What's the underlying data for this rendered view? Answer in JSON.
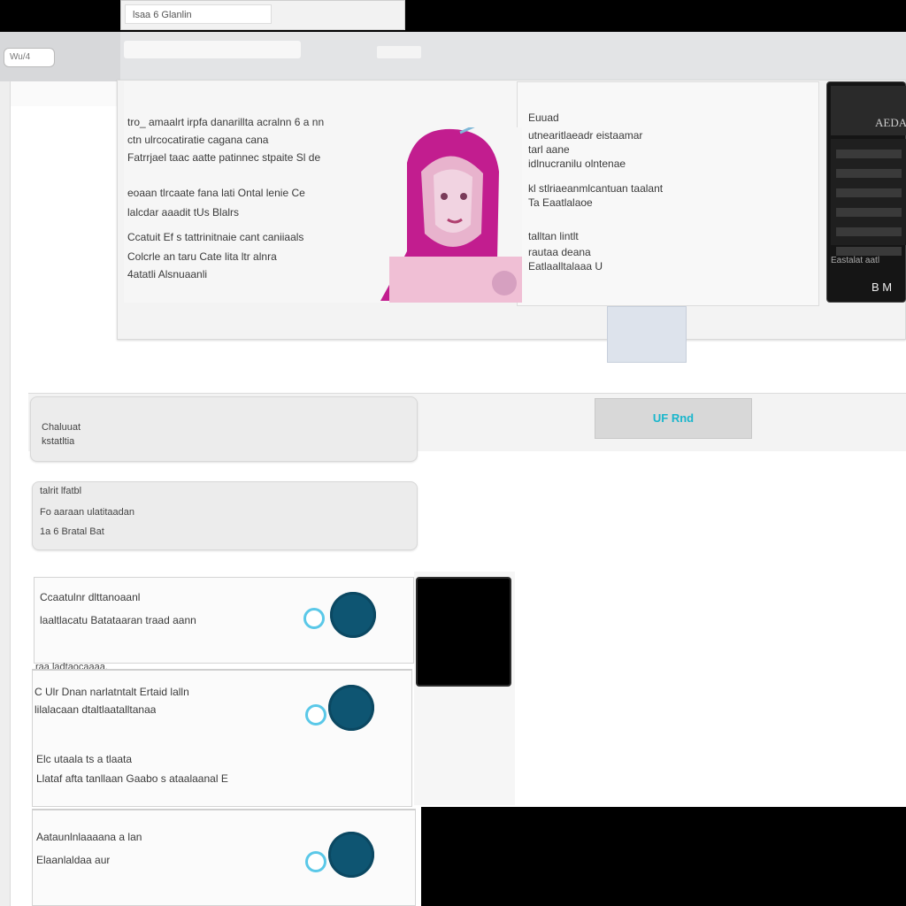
{
  "window": {
    "tab_label": "lsaa  6  Glanlin"
  },
  "toolbar": {
    "badge": "Wu/4"
  },
  "document": {
    "left_lines": [
      "tro_ amaalrt irpfa  danarillta acralnn  6 a nn",
      "ctn ulrcocatiratie cagana cana",
      "Fatrrjael  taac aatte patinnec  stpaite  Sl  de",
      "eoaan tlrcaate  fana lati  Ontal lenie Ce",
      "lalcdar  aaadit  tUs  Blalrs",
      "Ccatuit Ef s tattrinitnaie cant caniiaals",
      "Colcrle  an  taru  Cate lita ltr  alnra",
      "4atatli  Alsnuaanli"
    ],
    "right_lines": [
      "Euuad",
      "utnearitlaeadr  eistaamar",
      "tarl aane",
      "idlnucranilu  olntenae",
      "kl  stlriaeanmlcantuan  taalant",
      "Ta  Eaatlalaoe",
      "talltan lintlt",
      "rautaa deana",
      "Eatlaalltalaaa  U"
    ],
    "dark_header": "AEDAL",
    "dark_footer": "Eastalat aatl",
    "dark_page": "B  M"
  },
  "filter": {
    "button_label": "UF Rnd"
  },
  "search_card": {
    "line1": "Chaluuat",
    "line2": "kstatltia"
  },
  "info_card": {
    "line1": "talrit lfatbl",
    "line2": "Fo  aaraan ulatitaadan",
    "line3": "1a  6  Bratal  Bat"
  },
  "rows": [
    {
      "title": "Ccaatulnr  dlttanoaanl",
      "subtitle": "laaltlacatu  Batataaran traad aann"
    },
    {
      "separator": "raa ladtaocaaaa.",
      "title": "C  Ulr Dnan  narlatntalt   Ertaid lalln",
      "subtitle": "lilalacaan dtaltlaatalltanaa",
      "line3": "Elc utaala ts a tlaata",
      "line4": "Llataf  afta tanllaan Gaabo s ataalaanal E"
    },
    {
      "title": "Aataunlnlaaaana  a  lan",
      "subtitle": "Elaanlaldaa aur"
    }
  ]
}
